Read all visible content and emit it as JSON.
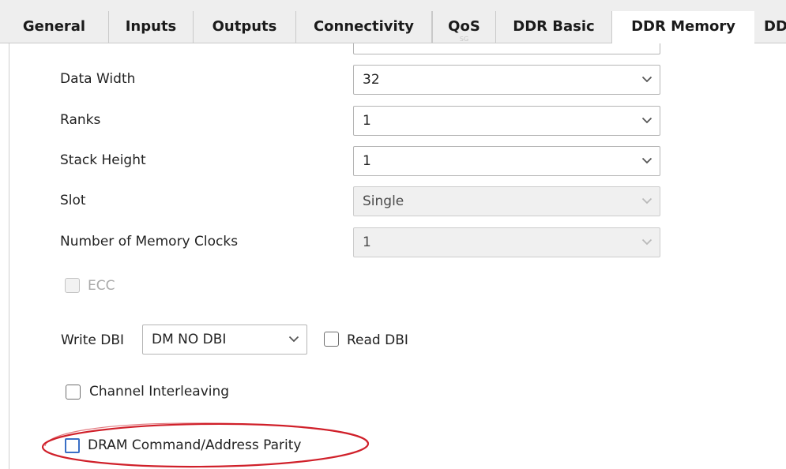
{
  "tabs": [
    {
      "label": "General"
    },
    {
      "label": "Inputs"
    },
    {
      "label": "Outputs"
    },
    {
      "label": "Connectivity"
    },
    {
      "label": "QoS",
      "mark": "SG"
    },
    {
      "label": "DDR Basic"
    },
    {
      "label": "DDR Memory",
      "active": true
    },
    {
      "label": "DD"
    }
  ],
  "form": {
    "data_width": {
      "label": "Data Width",
      "value": "32"
    },
    "ranks": {
      "label": "Ranks",
      "value": "1"
    },
    "stack_height": {
      "label": "Stack Height",
      "value": "1"
    },
    "slot": {
      "label": "Slot",
      "value": "Single",
      "disabled": true
    },
    "memory_clocks": {
      "label": "Number of Memory Clocks",
      "value": "1",
      "disabled": true
    },
    "ecc": {
      "label": "ECC",
      "checked": false,
      "disabled": true
    },
    "write_dbi": {
      "label": "Write DBI",
      "value": "DM NO DBI"
    },
    "read_dbi": {
      "label": "Read DBI",
      "checked": false
    },
    "channel_interleaving": {
      "label": "Channel Interleaving",
      "checked": false
    },
    "dram_parity": {
      "label": "DRAM Command/Address Parity",
      "checked": false,
      "focused": true
    }
  },
  "colors": {
    "highlight_ellipse": "#d0202a",
    "focus_blue": "#3a6fc6",
    "tab_strip_bg": "#eeeeee"
  }
}
